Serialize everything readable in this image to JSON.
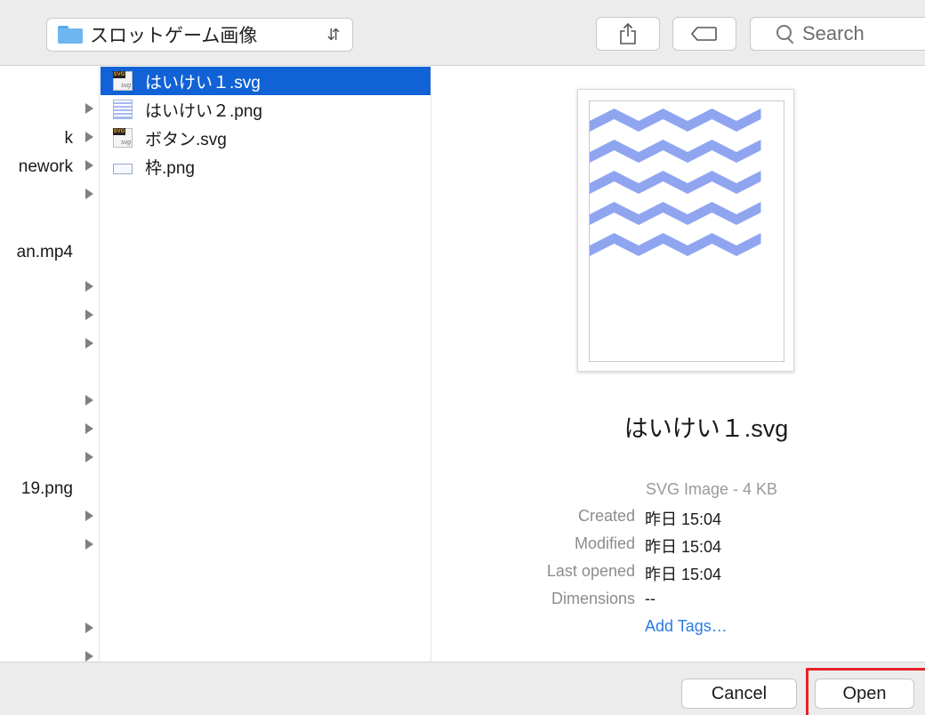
{
  "toolbar": {
    "folder_name": "スロットゲーム画像",
    "folder_icon": "folder-icon",
    "share_icon": "share-icon",
    "tag_icon": "tag-icon",
    "search_placeholder": "Search"
  },
  "left_column": {
    "rows": [
      {
        "label": "",
        "has_arrow": false
      },
      {
        "label": "",
        "has_arrow": true
      },
      {
        "label": "k",
        "has_arrow": true
      },
      {
        "label": "nework",
        "has_arrow": true
      },
      {
        "label": "",
        "has_arrow": true
      },
      {
        "label": "",
        "has_arrow": false
      },
      {
        "label": "an.mp4",
        "has_arrow": false
      },
      {
        "label": "",
        "has_arrow": true
      },
      {
        "label": "",
        "has_arrow": true
      },
      {
        "label": "",
        "has_arrow": true
      },
      {
        "label": "",
        "has_arrow": false
      },
      {
        "label": "",
        "has_arrow": true
      },
      {
        "label": "",
        "has_arrow": true
      },
      {
        "label": "",
        "has_arrow": true
      },
      {
        "label": "19.png",
        "has_arrow": false
      },
      {
        "label": "",
        "has_arrow": true
      },
      {
        "label": "",
        "has_arrow": true
      },
      {
        "label": "",
        "has_arrow": false
      },
      {
        "label": "",
        "has_arrow": false
      },
      {
        "label": "",
        "has_arrow": true
      },
      {
        "label": "",
        "has_arrow": true
      }
    ]
  },
  "files": [
    {
      "name": "はいけい１.svg",
      "icon": "svg-file-icon",
      "selected": true
    },
    {
      "name": "はいけい２.png",
      "icon": "png-pattern-icon",
      "selected": false
    },
    {
      "name": "ボタン.svg",
      "icon": "svg-file-icon",
      "selected": false
    },
    {
      "name": "枠.png",
      "icon": "png-frame-icon",
      "selected": false
    }
  ],
  "preview": {
    "file_name": "はいけい１.svg",
    "kind": "SVG Image - 4 KB",
    "created_label": "Created",
    "created_value": "昨日 15:04",
    "modified_label": "Modified",
    "modified_value": "昨日 15:04",
    "last_opened_label": "Last opened",
    "last_opened_value": "昨日 15:04",
    "dimensions_label": "Dimensions",
    "dimensions_value": "--",
    "add_tags": "Add Tags…",
    "pattern_color": "#8fa5f0"
  },
  "buttons": {
    "cancel": "Cancel",
    "open": "Open"
  },
  "colors": {
    "selection": "#1162d6",
    "link": "#2a7ae2",
    "highlight": "#e8222a"
  }
}
